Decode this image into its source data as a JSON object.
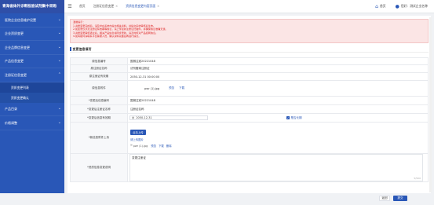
{
  "sidebar": {
    "title": "青海省体外诊断检验试剂集中采购",
    "items": [
      {
        "label": "医院企业信息维护设置",
        "expanded": false
      },
      {
        "label": "企业资质变更",
        "expanded": false
      },
      {
        "label": "企业品牌信息变更",
        "expanded": false
      },
      {
        "label": "产品信息变更",
        "expanded": false
      },
      {
        "label": "注册证信息变更",
        "expanded": true
      }
    ],
    "subitems": [
      {
        "label": "资质变更列表",
        "active": true
      },
      {
        "label": "资质变更确认",
        "active": false
      }
    ],
    "items_after": [
      {
        "label": "产品目录",
        "expanded": false
      },
      {
        "label": "价格调整",
        "expanded": false
      }
    ]
  },
  "topbar": {
    "tabs": [
      {
        "label": "首页",
        "active": false,
        "closable": false
      },
      {
        "label": "注册证信息变更",
        "active": false,
        "closable": true
      },
      {
        "label": "资质信息变更内容页面",
        "active": true,
        "closable": true
      }
    ],
    "home_label": "首页",
    "user_label": "您好：测试企业名称"
  },
  "notice": {
    "lines": [
      "温馨提示：",
      "1.资质变更完成后，请及时在系统内提交相关资料，并提交系统审核后生效。",
      "2.如变更仅涉及注册证有效期等信息，请上传最新注册证扫描件，并确保信息准确无误。",
      "3.资质变更审核通过后，相关产品信息将同步更新，请及时核对产品挂网信息。",
      "4.如有疑问请联系平台客服人员，确认资料完整后再进行提交。"
    ]
  },
  "section_title": "变更信息填写",
  "form": {
    "rows": [
      {
        "label": "原信息编号",
        "value": "国械注准20221048"
      },
      {
        "label": "原注册证名称",
        "value": "试剂备案注册证"
      },
      {
        "label": "原注册证有效期",
        "value": "2050-12-31 00:00:00"
      },
      {
        "label": "原信息附件",
        "value": "pwr (1).jpg",
        "link1": "预览",
        "link2": "下载"
      },
      {
        "label": "*变更后信息编号",
        "value": "国械注准20221048"
      },
      {
        "label": "*变更后注册证名称",
        "value": "注册证名称"
      },
      {
        "label": "*变更后信息有效期",
        "value": "2050-12-31",
        "checkbox_label": "是否长期",
        "checked": true
      },
      {
        "label": "*新信息附件上传",
        "button": "点击上传",
        "tip": "请上传图片",
        "file": "pwr (1).jpg",
        "file_links": [
          "预览",
          "下载",
          "删除"
        ]
      },
      {
        "label": "*资质信息变更说明",
        "value": "变更注册证",
        "counter": "5/500"
      }
    ]
  },
  "buttons": {
    "back": "返回",
    "submit": "提交"
  },
  "colors": {
    "primary": "#2957b7",
    "notice": "#d22222"
  }
}
